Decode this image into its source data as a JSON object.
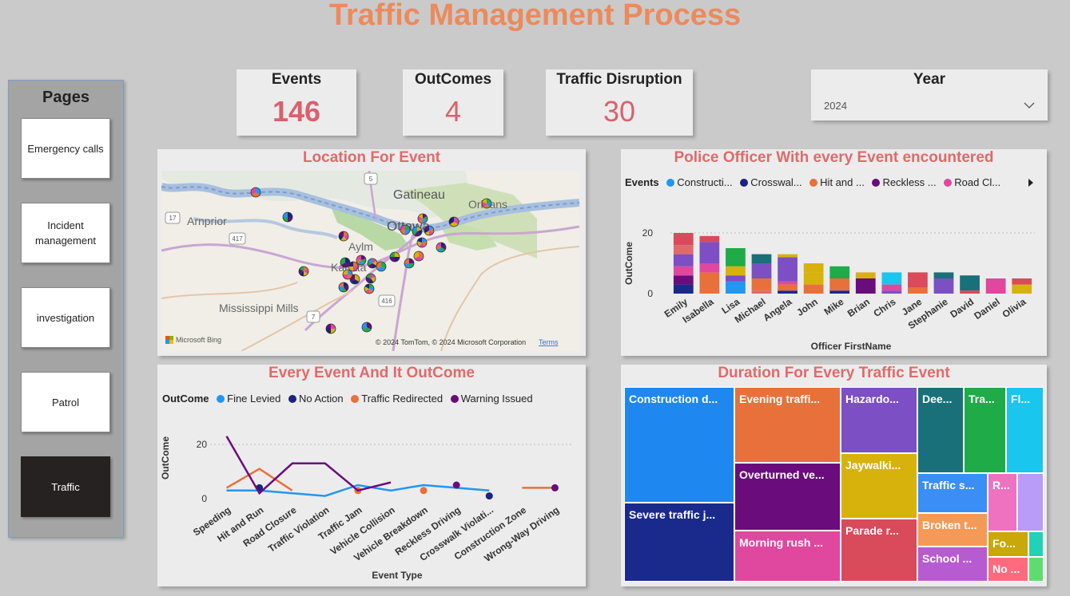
{
  "title": "Traffic Management Process",
  "nav": {
    "heading": "Pages",
    "items": [
      {
        "label": "Emergency calls"
      },
      {
        "label": "Incident management"
      },
      {
        "label": "investigation"
      },
      {
        "label": "Patrol"
      },
      {
        "label": "Traffic"
      }
    ],
    "active": "Traffic"
  },
  "kpis": [
    {
      "label": "Events",
      "value": "146"
    },
    {
      "label": "OutComes",
      "value": "4"
    },
    {
      "label": "Traffic Disruption",
      "value": "30"
    }
  ],
  "year_slicer": {
    "label": "Year",
    "selected": "2024",
    "icon": "chevron-down-icon"
  },
  "map": {
    "title": "Location For Event",
    "places": {
      "gatineau": "Gatineau",
      "ottawa": "Ottawa",
      "arnprior": "Arnprior",
      "orleans": "Orleans",
      "aylmer": "Aylm",
      "kanata": "Kanata",
      "mississippi": "Mississippi Mills"
    },
    "shields": {
      "s5": "5",
      "s17": "17",
      "s417": "417",
      "s416": "416",
      "s7": "7"
    },
    "brand": "Microsoft Bing",
    "copyright": "© 2024 TomTom, © 2024 Microsoft Corporation",
    "terms": "Terms"
  },
  "officers": {
    "title": "Police Officer With every Event encountered",
    "legend_title": "Events",
    "legend": [
      {
        "label": "Constructi...",
        "color": "#2196f3"
      },
      {
        "label": "Crosswal...",
        "color": "#1a237e"
      },
      {
        "label": "Hit and ...",
        "color": "#e8703a"
      },
      {
        "label": "Reckless ...",
        "color": "#6a0c7c"
      },
      {
        "label": "Road Cl...",
        "color": "#e0479e"
      }
    ],
    "more_icon": "chevron-right-icon"
  },
  "outcomes": {
    "title": "Every Event And It OutCome",
    "legend_title": "OutCome",
    "legend": [
      {
        "label": "Fine Levied",
        "color": "#2196f3"
      },
      {
        "label": "No Action",
        "color": "#1a237e"
      },
      {
        "label": "Traffic Redirected",
        "color": "#e8703a"
      },
      {
        "label": "Warning Issued",
        "color": "#6a0c7c"
      }
    ]
  },
  "treemap": {
    "title": "Duration For Every Traffic Event",
    "tiles": [
      {
        "label": "Construction d...",
        "color": "#1e88f0"
      },
      {
        "label": "Severe traffic j...",
        "color": "#1a2a8c"
      },
      {
        "label": "Evening traffi...",
        "color": "#e8703a"
      },
      {
        "label": "Overturned ve...",
        "color": "#6a0c7c"
      },
      {
        "label": "Morning rush ...",
        "color": "#e0479e"
      },
      {
        "label": "Hazardo...",
        "color": "#7c4fc4"
      },
      {
        "label": "Jaywalki...",
        "color": "#d8b20c"
      },
      {
        "label": "Parade r...",
        "color": "#d94a5a"
      },
      {
        "label": "Dee...",
        "color": "#1a7078"
      },
      {
        "label": "Tra...",
        "color": "#1fab48"
      },
      {
        "label": "Fl...",
        "color": "#18c6ee"
      },
      {
        "label": "Traffic s...",
        "color": "#3a8ef5"
      },
      {
        "label": "Broken t...",
        "color": "#f59a56"
      },
      {
        "label": "School ...",
        "color": "#b65cd0"
      },
      {
        "label": "R...",
        "color": "#ef72c0"
      },
      {
        "label": "",
        "color": "#b89cf7"
      },
      {
        "label": "Fo...",
        "color": "#c8a80b"
      },
      {
        "label": "No ...",
        "color": "#ff6b7e"
      },
      {
        "label": "",
        "color": "#22d1b6"
      },
      {
        "label": "",
        "color": "#5fdc70"
      }
    ]
  },
  "chart_data": [
    {
      "type": "bar",
      "title": "Police Officer With every Event encountered",
      "xlabel": "Officer FirstName",
      "ylabel": "OutCome",
      "ylim": [
        0,
        22
      ],
      "yticks": [
        0,
        20
      ],
      "stacked": true,
      "categories": [
        "Emily",
        "Isabella",
        "Lisa",
        "Michael",
        "Angela",
        "John",
        "Mike",
        "Brian",
        "Chris",
        "Jane",
        "Stephanie",
        "David",
        "Daniel",
        "Olivia"
      ],
      "stacks": [
        [
          {
            "c": "#1a2a8c",
            "v": 3
          },
          {
            "c": "#6a0c7c",
            "v": 3
          },
          {
            "c": "#e0479e",
            "v": 3
          },
          {
            "c": "#7c4fc4",
            "v": 4
          },
          {
            "c": "#e06a6a",
            "v": 3
          },
          {
            "c": "#d94a5a",
            "v": 4
          }
        ],
        [
          {
            "c": "#e8703a",
            "v": 7
          },
          {
            "c": "#e0479e",
            "v": 3
          },
          {
            "c": "#7c4fc4",
            "v": 7
          },
          {
            "c": "#d94a5a",
            "v": 2
          }
        ],
        [
          {
            "c": "#2196f3",
            "v": 4
          },
          {
            "c": "#7c4fc4",
            "v": 2
          },
          {
            "c": "#d8b20c",
            "v": 3
          },
          {
            "c": "#1fab48",
            "v": 6
          }
        ],
        [
          {
            "c": "#e06a6a",
            "v": 1
          },
          {
            "c": "#e8703a",
            "v": 4
          },
          {
            "c": "#7c4fc4",
            "v": 5
          },
          {
            "c": "#1a7078",
            "v": 3
          }
        ],
        [
          {
            "c": "#1a2a8c",
            "v": 1
          },
          {
            "c": "#e8703a",
            "v": 2
          },
          {
            "c": "#e0479e",
            "v": 1
          },
          {
            "c": "#7c4fc4",
            "v": 8
          },
          {
            "c": "#d8b20c",
            "v": 1
          }
        ],
        [
          {
            "c": "#e8703a",
            "v": 3
          },
          {
            "c": "#d8b20c",
            "v": 4
          },
          {
            "c": "#d8b20c",
            "v": 3
          }
        ],
        [
          {
            "c": "#1a2a8c",
            "v": 1
          },
          {
            "c": "#e8703a",
            "v": 4
          },
          {
            "c": "#1fab48",
            "v": 4
          }
        ],
        [
          {
            "c": "#6a0c7c",
            "v": 5
          },
          {
            "c": "#d8b20c",
            "v": 2
          }
        ],
        [
          {
            "c": "#7c4fc4",
            "v": 1
          },
          {
            "c": "#e0479e",
            "v": 2
          },
          {
            "c": "#18c6ee",
            "v": 4
          }
        ],
        [
          {
            "c": "#e8703a",
            "v": 2
          },
          {
            "c": "#d94a5a",
            "v": 5
          }
        ],
        [
          {
            "c": "#7c4fc4",
            "v": 5
          },
          {
            "c": "#1a7078",
            "v": 2
          }
        ],
        [
          {
            "c": "#d94a5a",
            "v": 1
          },
          {
            "c": "#1a7078",
            "v": 5
          }
        ],
        [
          {
            "c": "#e0479e",
            "v": 5
          }
        ],
        [
          {
            "c": "#d8b20c",
            "v": 3
          },
          {
            "c": "#d94a5a",
            "v": 2
          }
        ]
      ]
    },
    {
      "type": "line",
      "title": "Every Event And It OutCome",
      "xlabel": "Event Type",
      "ylabel": "OutCome",
      "ylim": [
        0,
        25
      ],
      "yticks": [
        0,
        20
      ],
      "categories": [
        "Speeding",
        "Hit and Run",
        "Road Closure",
        "Traffic Violation",
        "Traffic Jam",
        "Vehicle Collision",
        "Vehicle Breakdown",
        "Reckless Driving",
        "Crosswalk Violati...",
        "Construction Zone",
        "Wrong-Way Driving"
      ],
      "series": [
        {
          "name": "Fine Levied",
          "color": "#2196f3",
          "values": [
            3,
            3,
            2,
            1,
            5,
            3,
            5,
            4,
            3,
            null,
            null
          ]
        },
        {
          "name": "No Action",
          "color": "#1a237e",
          "values": [
            null,
            4,
            null,
            null,
            null,
            null,
            null,
            null,
            1,
            null,
            null
          ]
        },
        {
          "name": "Traffic Redirected",
          "color": "#e8703a",
          "values": [
            4,
            11,
            3,
            null,
            3,
            null,
            3,
            null,
            null,
            4,
            4
          ]
        },
        {
          "name": "Warning Issued",
          "color": "#6a0c7c",
          "values": [
            23,
            2,
            13,
            13,
            3,
            6,
            null,
            5,
            null,
            null,
            4
          ]
        }
      ]
    }
  ]
}
